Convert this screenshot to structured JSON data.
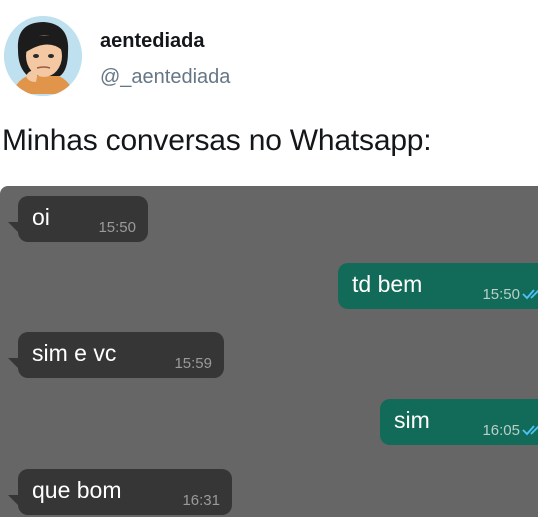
{
  "tweet": {
    "display_name": "aentediada",
    "handle": "@_aentediada",
    "text": "Minhas conversas no Whatsapp:"
  },
  "chat": {
    "messages": [
      {
        "direction": "incoming",
        "text": "oi",
        "time": "15:50"
      },
      {
        "direction": "outgoing",
        "text": "td bem",
        "time": "15:50",
        "status": "read"
      },
      {
        "direction": "incoming",
        "text": "sim e vc",
        "time": "15:59"
      },
      {
        "direction": "outgoing",
        "text": "sim",
        "time": "16:05",
        "status": "read"
      },
      {
        "direction": "incoming",
        "text": "que bom",
        "time": "16:31"
      }
    ],
    "colors": {
      "background": "#666666",
      "incoming_bubble": "#363636",
      "outgoing_bubble": "#126a58",
      "read_ticks": "#4fc3f7"
    }
  }
}
